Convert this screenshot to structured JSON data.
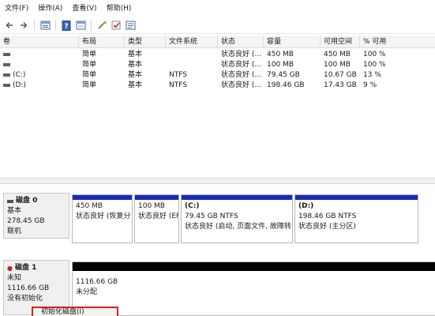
{
  "menu": [
    "文件(F)",
    "操作(A)",
    "查看(V)",
    "帮助(H)"
  ],
  "toolbar": {
    "icons": [
      "back-arrow-icon",
      "forward-arrow-icon",
      "volume-list-icon",
      "help-icon",
      "properties-icon",
      "connect-icon",
      "check-icon",
      "refresh-icon"
    ]
  },
  "volume_table": {
    "headers": [
      "卷",
      "布局",
      "类型",
      "文件系统",
      "状态",
      "容量",
      "可用空间",
      "% 可用"
    ],
    "rows": [
      {
        "vol": "",
        "layout": "简单",
        "type": "基本",
        "fs": "",
        "status": "状态良好 (...",
        "capacity": "450 MB",
        "free": "450 MB",
        "pct": "100 %"
      },
      {
        "vol": "",
        "layout": "简单",
        "type": "基本",
        "fs": "",
        "status": "状态良好 (...",
        "capacity": "100 MB",
        "free": "100 MB",
        "pct": "100 %"
      },
      {
        "vol": "(C:)",
        "layout": "简单",
        "type": "基本",
        "fs": "NTFS",
        "status": "状态良好 (...",
        "capacity": "79.45 GB",
        "free": "10.67 GB",
        "pct": "13 %"
      },
      {
        "vol": "(D:)",
        "layout": "简单",
        "type": "基本",
        "fs": "NTFS",
        "status": "状态良好 (...",
        "capacity": "198.46 GB",
        "free": "17.43 GB",
        "pct": "9 %"
      }
    ]
  },
  "disk0": {
    "name": "磁盘 0",
    "type": "基本",
    "size": "278.45 GB",
    "status": "联机",
    "partitions": [
      {
        "name": "",
        "size": "450 MB",
        "status": "状态良好 (恢复分"
      },
      {
        "name": "",
        "size": "100 MB",
        "status": "状态良好 (EFI"
      },
      {
        "name": "(C:)",
        "size": "79.45 GB NTFS",
        "status": "状态良好 (启动, 页面文件, 故障转"
      },
      {
        "name": "(D:)",
        "size": "198.46 GB NTFS",
        "status": "状态良好 (主分区)"
      }
    ]
  },
  "disk1": {
    "name": "磁盘 1",
    "type": "未知",
    "size": "1116.66 GB",
    "status": "没有初始化",
    "partition": {
      "size": "1116.66 GB",
      "status": "未分配"
    }
  },
  "context_menu": {
    "item": "初始化磁盘(I)"
  },
  "colors": {
    "partition_bar": "#1a2ab8",
    "unallocated_bar": "#000000",
    "highlight_border": "#e02020"
  }
}
